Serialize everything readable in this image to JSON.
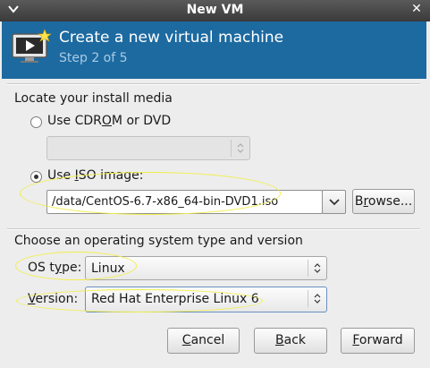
{
  "window": {
    "title": "New VM"
  },
  "banner": {
    "heading": "Create a new virtual machine",
    "step": "Step 2 of 5"
  },
  "install_media": {
    "section_label": "Locate your install media",
    "cdrom_label": "Use CDROM or DVD",
    "cdrom_selected": false,
    "cdrom_device_value": "",
    "iso_label": "Use ISO image:",
    "iso_selected": true,
    "iso_path": "/data/CentOS-6.7-x86_64-bin-DVD1.iso",
    "browse_label": "Browse..."
  },
  "os": {
    "section_label": "Choose an operating system type and version",
    "type_label": "OS type:",
    "type_value": "Linux",
    "version_label": "Version:",
    "version_value": "Red Hat Enterprise Linux 6"
  },
  "buttons": {
    "cancel": "Cancel",
    "back": "Back",
    "forward": "Forward"
  }
}
